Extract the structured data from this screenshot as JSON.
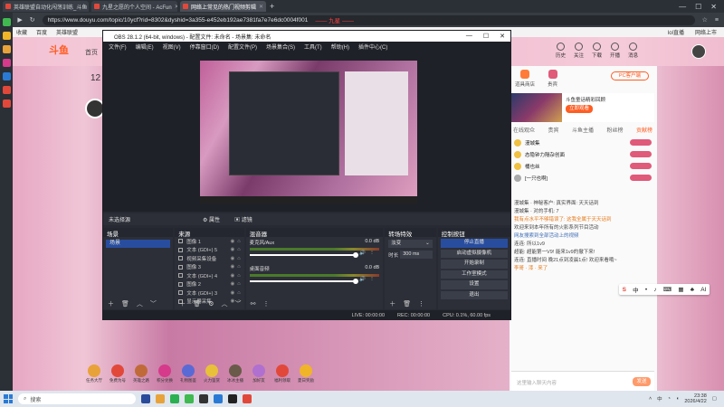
{
  "browser": {
    "tabs": [
      {
        "label": "英雄联盟自动化闯荡训练_斗鱼",
        "active": false,
        "color": "#e2483a"
      },
      {
        "label": "九星之愿的个人空间 - AcFun",
        "active": false,
        "color": "#e2483a"
      },
      {
        "label": "网络上常见的热门视频剪辑",
        "active": true,
        "color": "#e2483a"
      }
    ],
    "new_tab": "+",
    "window_controls": [
      "—",
      "☐",
      "✕"
    ],
    "url": "https://www.douyu.com/topic/10ycf?rid=8302&dyshid=3a355-e452eb192ae7381fa7e7e6dc0004f001",
    "url_overlay": "—— 九星 ——",
    "bookmarks": [
      "收藏",
      "百度",
      "英雄联盟"
    ],
    "bookmarks_right": [
      "lol直播",
      "网络上市"
    ]
  },
  "douyu": {
    "logo": "斗鱼",
    "home": "首页",
    "header_icons": [
      "历史",
      "关注",
      "下载",
      "开播",
      "消息"
    ],
    "streamer_number": "12",
    "pc_button": "PC客户端",
    "chat_top": [
      "道具商店",
      "贵宾"
    ],
    "banner_title": "斗鱼童话精彩回顾",
    "banner_button": "立即观看",
    "chat_tabs": [
      "在线观众",
      "贵宾",
      "斗鱼主播",
      "粉丝榜",
      "贡献榜"
    ],
    "rank_rows": [
      "漫城集",
      "态隐钟力隔杂创面",
      "桶也丝",
      "[一只也啊]"
    ],
    "messages": [
      {
        "text": "漫城集 · 神秘客户: 真实界面: 天天话到",
        "style": "normal"
      },
      {
        "text": "漫城集 · 对的手机: 7",
        "style": "normal"
      },
      {
        "text": "我有点水平不够错误了: 这我全属于天天话到",
        "style": "hl"
      },
      {
        "text": "欢迎来到本年所有的火影系列节目活动",
        "style": "normal"
      },
      {
        "text": "网友搜索到全部活动上的视频",
        "style": "blue"
      },
      {
        "text": "连连: 所以1v9",
        "style": "normal"
      },
      {
        "text": "超能: 超能第一V9! 能来1v9的撤下来!",
        "style": "normal"
      },
      {
        "text": "连连: 直播时间 晚21点到凌晨1点! 欢迎来看哦~",
        "style": "normal"
      },
      {
        "text": "李哥 · 漆 · 来了",
        "style": "hl"
      }
    ],
    "chat_placeholder": "这里输入聊天内容",
    "send": "发送",
    "float_toolbar": [
      "S",
      "中",
      "•",
      "♪",
      "⌨",
      "▦",
      "♣",
      "AI"
    ],
    "gifts": [
      "任务大厅",
      "免费为号",
      "英雄之路",
      "积分兑换",
      "礼物图鉴",
      "火力鉴赏",
      "冰冰主播",
      "加好友",
      "福利领取",
      "夏日奖励"
    ]
  },
  "obs": {
    "title": "OBS 28.1.2 (64-bit, windows) - 配置文件: 未命名 - 场景集: 未命名",
    "menu": [
      "文件(F)",
      "编辑(E)",
      "视图(V)",
      "停靠窗口(D)",
      "配置文件(P)",
      "场景集合(S)",
      "工具(T)",
      "帮助(H)",
      "插件中心(C)"
    ],
    "context_label": "未选择源",
    "context_buttons": [
      "⚙ 属性",
      "▣ 滤镜"
    ],
    "docks": {
      "scenes": {
        "title": "场景",
        "items": [
          "场景"
        ]
      },
      "sources": {
        "title": "来源",
        "items": [
          "图像 1",
          "文本 (GDI+) 5",
          "视频采集设备",
          "图像 3",
          "文本 (GDI+) 4",
          "图像 2",
          "文本 (GDI+) 3",
          "显示器采集"
        ]
      },
      "mixer": {
        "title": "混音器",
        "channels": [
          {
            "name": "麦克风/Aux",
            "db": "0.0 dB"
          },
          {
            "name": "桌面音频",
            "db": "0.0 dB"
          }
        ]
      },
      "transitions": {
        "title": "转场特效",
        "type": "淡变",
        "duration_label": "时长",
        "duration": "300 ms"
      },
      "controls": {
        "title": "控制按钮",
        "buttons": [
          "停止直播",
          "启动虚拟摄像机",
          "开始录制",
          "工作室模式",
          "设置",
          "退出"
        ],
        "active_index": 0
      }
    },
    "status": {
      "live": "LIVE: 00:00:00",
      "rec": "REC: 00:00:00",
      "cpu": "CPU: 0.1%, 60.00 fps"
    }
  },
  "taskbar": {
    "search": "搜索",
    "time": "23:38",
    "date": "2026/4/22",
    "lang": "中"
  }
}
